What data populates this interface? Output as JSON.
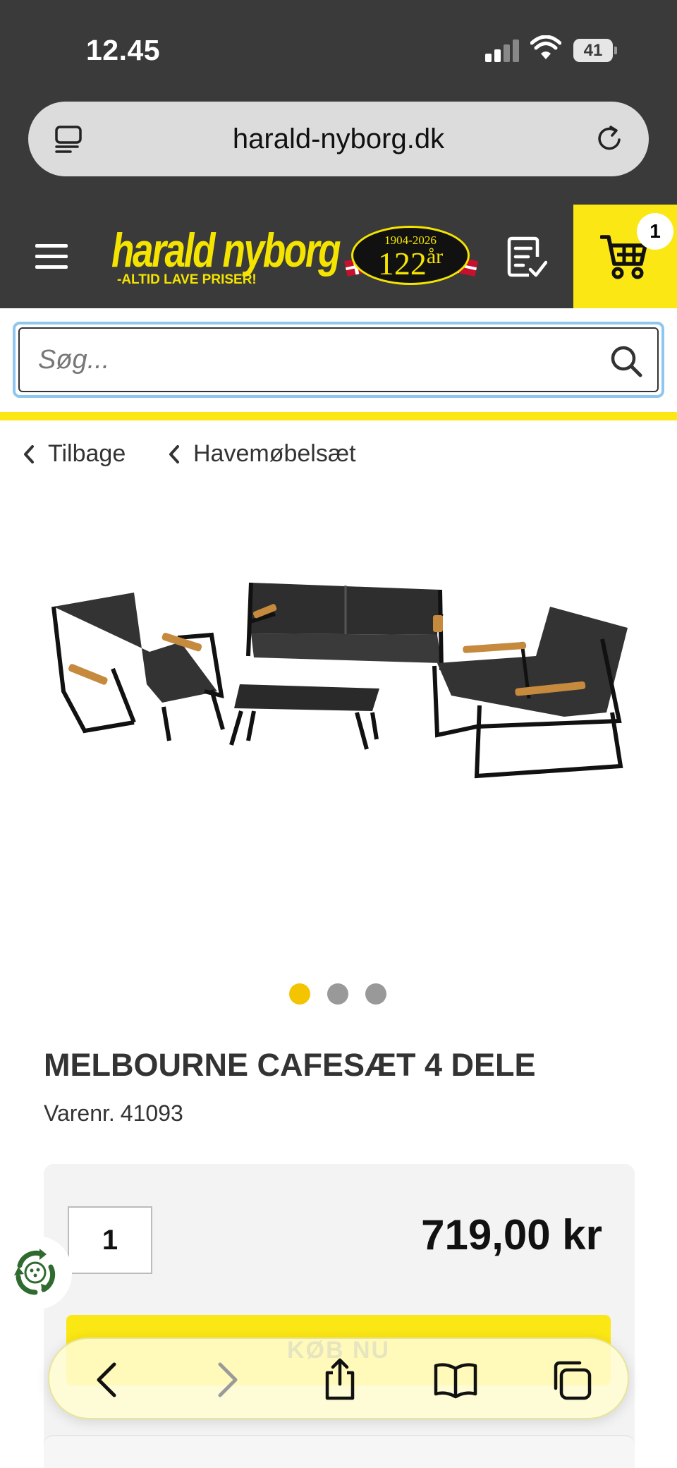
{
  "status_bar": {
    "time": "12.45",
    "battery": "41"
  },
  "browser": {
    "url": "harald-nyborg.dk"
  },
  "header": {
    "logo_name": "harald nyborg",
    "logo_tagline": "-ALTID LAVE PRISER!",
    "badge_years": "1904-2026",
    "badge_count": "122",
    "badge_unit": "år",
    "cart_count": "1",
    "brand_yellow": "#fbe714",
    "header_bg": "#3a3a3a"
  },
  "search": {
    "placeholder": "Søg..."
  },
  "breadcrumb": {
    "back_label": "Tilbage",
    "category_label": "Havemøbelsæt"
  },
  "gallery": {
    "slide_count": 3,
    "active_index": 0
  },
  "product": {
    "title": "MELBOURNE CAFESÆT 4 DELE",
    "sku_label": "Varenr.",
    "sku": "41093",
    "quantity": "1",
    "price": "719,00 kr",
    "add_button_label": "KØB NU"
  },
  "icons": {
    "url_left": "reader-icon",
    "reload": "reload-icon",
    "menu": "hamburger-menu-icon",
    "list": "shopping-list-icon",
    "cart": "cart-icon",
    "search": "search-icon",
    "recycle": "recycle-icon",
    "toolbar": [
      "back-icon",
      "forward-icon",
      "share-icon",
      "bookmarks-icon",
      "tabs-icon"
    ]
  }
}
